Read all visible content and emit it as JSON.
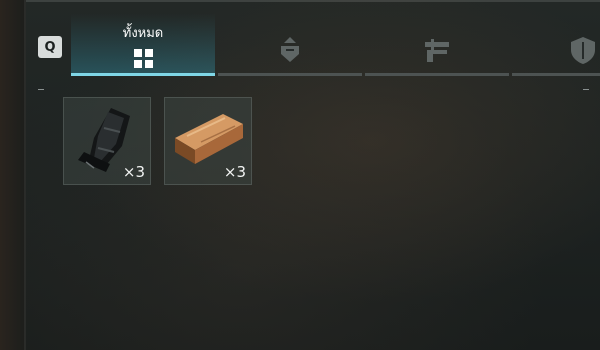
{
  "hotkey": {
    "label": "Q"
  },
  "tabs": [
    {
      "label": "ทั้งหมด",
      "icon": "grid-icon",
      "active": true
    },
    {
      "label": "",
      "icon": "armor-gem-icon",
      "active": false
    },
    {
      "label": "",
      "icon": "weapon-icon",
      "active": false
    },
    {
      "label": "",
      "icon": "shield-icon",
      "active": false
    }
  ],
  "inventory": {
    "items": [
      {
        "icon": "black-cloth-roll-icon",
        "count": "×3"
      },
      {
        "icon": "copper-ingot-icon",
        "count": "×3"
      }
    ]
  },
  "colors": {
    "accent": "#7fd6e6",
    "background": "#1d2221",
    "slot_border": "#96a5a0"
  }
}
